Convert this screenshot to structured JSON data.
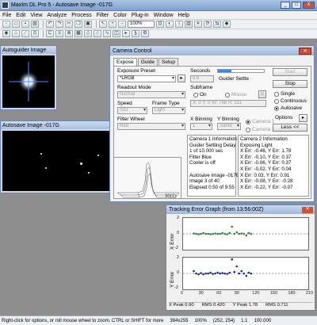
{
  "app": {
    "title": "MaxIm DL Pro 5 - Autosave Image -017G",
    "buttons": {
      "minimize": "_",
      "maximize": "□",
      "close": "X"
    }
  },
  "menu": [
    "File",
    "Edit",
    "View",
    "Analyze",
    "Process",
    "Filter",
    "Color",
    "Plug-in",
    "Window",
    "Help"
  ],
  "toolbar": {
    "zoom": "100%"
  },
  "autoguider_window": {
    "title": "Autoguider Image"
  },
  "autosave_window": {
    "title": "Autosave Image -017G"
  },
  "camera_control": {
    "title": "Camera Control",
    "tabs": [
      "Expose",
      "Guide",
      "Setup"
    ],
    "exposure_preset_label": "Exposure Preset",
    "exposure_preset_value": "*LRGB",
    "seconds_label": "Seconds",
    "seconds_value": "0.6",
    "status_text": "Guider Settle",
    "readout_label": "Readout Mode",
    "readout_value": "Normal",
    "subframe_label": "Subframe",
    "subframe_on": "On",
    "subframe_mouse": "Mouse",
    "subframe_coords": "X: 0 Y: 0 W: 768 H: 511",
    "speed_label": "Speed",
    "speed_value": "ISO",
    "frame_type_label": "Frame Type",
    "frame_type_value": "Light",
    "filter_wheel_label": "Filter Wheel",
    "filter_value": "Red",
    "x_binning_label": "X Binning",
    "x_binning_value": "1",
    "y_binning_label": "Y Binning",
    "y_binning_value": "Same",
    "camera1_radio": "Camera 1",
    "camera2_radio": "Camera 2",
    "buttons": {
      "start": "Start",
      "stop": "Stop",
      "options": "Options",
      "less": "Less <<"
    },
    "mode_options": [
      "Single",
      "Continuous",
      "Autosave"
    ],
    "mode_selected": "Autosave",
    "progress": 0.3,
    "camera2_info": "Camera 2 Information\nExposing Light\nX Err: -0.46, Y Err: 1.78\nX Err: -0.10, Y Err: 0.37\nX Err: -0.06, Y Err: 0.37\nX Err: -0.02, Y Err: 0.04\nX Err: 0.03, Y Err: 0.91\nX Err: -0.08, Y Err: -0.28\nX Err: -0.22, Y Err: -0.07",
    "camera1_info": "Camera 1 Information\nGuider Settling Delay\n1 of 10.000 sec\nFilter Blue\nCooler is off\n\nAutosave Image -017B\nImage 3 of 40\nElapsed 0:50 of 9:55",
    "profile_label": "30(1)"
  },
  "tracking_graph": {
    "title": "Tracking Error Graph (from 13:56:00Z)",
    "x_error_label": "X Error",
    "y_error_label": "Y Error",
    "y_ticks": [
      "2",
      "0",
      "-2"
    ],
    "x_ticks": [
      "0",
      "30",
      "60",
      "90",
      "120",
      "150",
      "180",
      "210"
    ],
    "x_peak": "X Peak 0.90",
    "x_rms": "RMS 0.420",
    "y_peak": "Y Peak 1.78",
    "y_rms": "RMS 0.711",
    "x_points": [
      [
        18,
        0.05
      ],
      [
        22,
        0
      ],
      [
        26,
        -0.05
      ],
      [
        30,
        0
      ],
      [
        34,
        0.1
      ],
      [
        38,
        0
      ],
      [
        42,
        0
      ],
      [
        46,
        -0.05
      ],
      [
        50,
        0
      ],
      [
        54,
        0.05
      ],
      [
        58,
        0
      ],
      [
        62,
        0
      ],
      [
        66,
        0.1
      ],
      [
        70,
        0
      ],
      [
        74,
        -0.05
      ],
      [
        78,
        0.1
      ],
      [
        82,
        0.9
      ],
      [
        86,
        0
      ],
      [
        90,
        0.2
      ],
      [
        94,
        0
      ],
      [
        98,
        0.05
      ],
      [
        102,
        0
      ],
      [
        106,
        -0.2
      ],
      [
        110,
        0.1
      ],
      [
        114,
        0
      ]
    ],
    "y_points": [
      [
        18,
        0.3
      ],
      [
        22,
        0
      ],
      [
        26,
        -0.1
      ],
      [
        30,
        0.05
      ],
      [
        34,
        -0.1
      ],
      [
        38,
        0
      ],
      [
        42,
        0
      ],
      [
        46,
        0.1
      ],
      [
        50,
        -0.05
      ],
      [
        54,
        0
      ],
      [
        58,
        0.1
      ],
      [
        62,
        0
      ],
      [
        66,
        0.05
      ],
      [
        70,
        0
      ],
      [
        74,
        -0.05
      ],
      [
        78,
        0.1
      ],
      [
        82,
        1.78
      ],
      [
        86,
        0.2
      ],
      [
        90,
        0.9
      ],
      [
        94,
        0
      ],
      [
        98,
        0.3
      ],
      [
        102,
        0
      ],
      [
        106,
        -0.3
      ],
      [
        110,
        0.1
      ],
      [
        114,
        0
      ]
    ]
  },
  "statusbar": {
    "hint": "Right-click for options, or roll mouse wheel to zoom. CTRL or SHIFT for more",
    "size": "384x255",
    "zoom": "100%",
    "cursor": "(252, 254)",
    "value": "1.1",
    "value2": "100.000"
  },
  "colors": {
    "accent": "#3b86e8",
    "x_series": "#2e7d32",
    "y_series": "#1a237e"
  }
}
